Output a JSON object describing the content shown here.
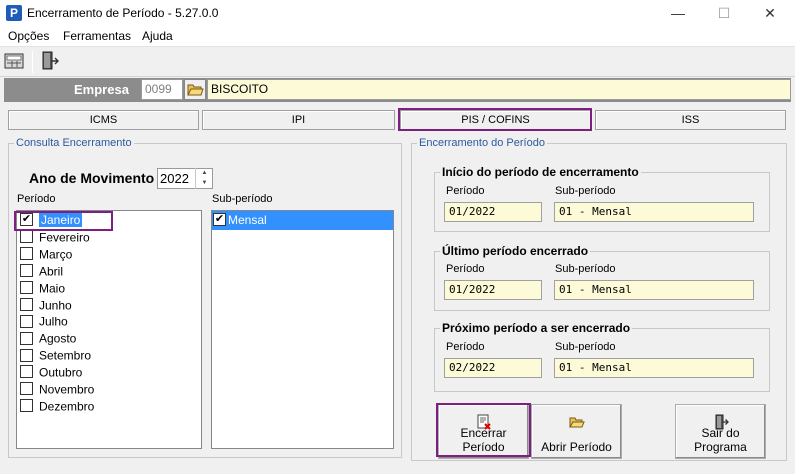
{
  "window": {
    "title": "Encerramento de Período - 5.27.0.0",
    "app_icon": "P",
    "minimize": "—",
    "maximize": "☐",
    "close": "✕"
  },
  "menu": {
    "items": [
      "Opções",
      "Ferramentas",
      "Ajuda"
    ]
  },
  "toolbar": {
    "buttons": [
      "calculator-icon",
      "exit-door-icon"
    ]
  },
  "empresa": {
    "label": "Empresa",
    "code": "0099",
    "name": "BISCOITO"
  },
  "tabs": [
    "ICMS",
    "IPI",
    "PIS / COFINS",
    "ISS"
  ],
  "active_tab": "PIS / COFINS",
  "consulta": {
    "title": "Consulta Encerramento",
    "ano_label": "Ano de Movimento",
    "ano_value": "2022",
    "periodo_label": "Período",
    "subperiodo_label": "Sub-período",
    "periodos": [
      "Janeiro",
      "Fevereiro",
      "Março",
      "Abril",
      "Maio",
      "Junho",
      "Julho",
      "Agosto",
      "Setembro",
      "Outubro",
      "Novembro",
      "Dezembro"
    ],
    "periodo_checked": [
      true,
      false,
      false,
      false,
      false,
      false,
      false,
      false,
      false,
      false,
      false,
      false
    ],
    "subperiodos": [
      "Mensal"
    ],
    "subperiodo_checked": [
      true
    ]
  },
  "encerramento": {
    "title": "Encerramento do Período",
    "periodo_label": "Período",
    "subperiodo_label": "Sub-período",
    "groups": [
      {
        "title": "Início do período de encerramento",
        "periodo": "01/2022",
        "subperiodo": "01 - Mensal"
      },
      {
        "title": "Último período encerrado",
        "periodo": "01/2022",
        "subperiodo": "01 - Mensal"
      },
      {
        "title": "Próximo período a ser encerrado",
        "periodo": "02/2022",
        "subperiodo": "01 - Mensal"
      }
    ]
  },
  "buttons": {
    "encerrar": "Encerrar Período",
    "abrir": "Abrir Período",
    "sair": "Sair do Programa"
  },
  "colors": {
    "highlight_border": "#7d1f7f",
    "selection": "#3390ff",
    "field_bg": "#fdfbd7",
    "group_title": "#2b5aa0"
  }
}
